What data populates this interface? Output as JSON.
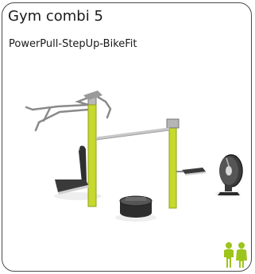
{
  "product": {
    "title": "Gym combi 5",
    "subtitle": "PowerPull-StepUp-BikeFit"
  },
  "colors": {
    "accent": "#c6d92c",
    "audience_icon": "#9dc41a",
    "frame": "#4a4a4a"
  },
  "icons": {
    "equipment": "outdoor-gym-illustration",
    "audience": "adults-seniors-icon"
  }
}
